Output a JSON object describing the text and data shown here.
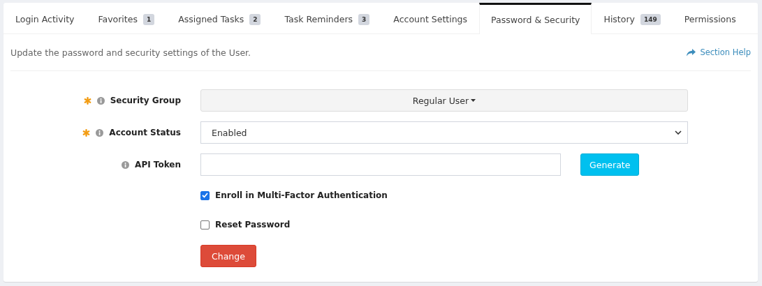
{
  "tabs": [
    {
      "label": "Login Activity",
      "selected": false
    },
    {
      "label": "Favorites",
      "badge": "1",
      "selected": false
    },
    {
      "label": "Assigned Tasks",
      "badge": "2",
      "selected": false
    },
    {
      "label": "Task Reminders",
      "badge": "3",
      "selected": false
    },
    {
      "label": "Account Settings",
      "selected": false
    },
    {
      "label": "Password & Security",
      "selected": true
    },
    {
      "label": "History",
      "badge": "149",
      "selected": false
    },
    {
      "label": "Permissions",
      "selected": false
    }
  ],
  "description": "Update the password and security settings of the User.",
  "section_help": "Section Help",
  "fields": [
    {
      "kind": "dropdown",
      "label": "Security Group",
      "required": true,
      "value": "Regular User"
    },
    {
      "kind": "select",
      "label": "Account Status",
      "required": true,
      "value": "Enabled"
    },
    {
      "kind": "token",
      "label": "API Token",
      "required": false,
      "button": "Generate"
    }
  ],
  "checkboxes": [
    {
      "label": "Enroll in Multi-Factor Authentication",
      "checked": true
    },
    {
      "label": "Reset Password",
      "checked": false
    }
  ],
  "submit": "Change"
}
